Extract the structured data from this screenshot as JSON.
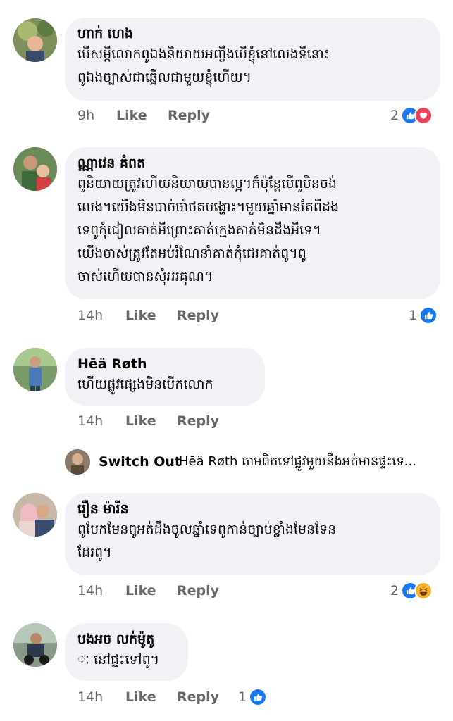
{
  "icons": {
    "like_color": "#1877f2",
    "love_color": "#f33e58",
    "haha_color": "#f7b125"
  },
  "comments": [
    {
      "author": "ហាក់ ហេង",
      "lines": [
        "បើសម្ដីលោកពូឯងនិយាយអញ្ចឹងបើខ្ញុំនៅលេងទីនោះ",
        "ពូឯងច្បាស់ជាឆ្អើលជាមួយខ្ញុំហើយ។"
      ],
      "time": "9h",
      "like": "Like",
      "reply": "Reply",
      "reaction_count": "2",
      "reactions": [
        "like-icon",
        "love-icon"
      ]
    },
    {
      "author": "ណ្ណាវេន គំពត",
      "lines": [
        "ពូនិយាយត្រូវហើយនិយាយបានល្អ។ក៏ប៉ុន្តែបើពូមិនចង់",
        "លេង។យើងមិនបាច់ចាំថតបង្ហោះ។មួយឆ្នាំមានតែពីដង",
        "ទេពូកុំជៀលគាត់អីព្រោះគាត់ក្មេងគាត់មិនដឹងអីទេ។",
        "យើងចាស់ត្រូវតែអប់រំណែនាំគាត់កុំជេរគាត់ពូ។ពូ",
        "ចាស់ហើយបានសុំអរគុណ។"
      ],
      "time": "14h",
      "like": "Like",
      "reply": "Reply",
      "reaction_count": "1",
      "reactions": [
        "like-icon"
      ]
    },
    {
      "author": "Hēä Røth",
      "lines": [
        "ហើយផ្លូវផ្សេងមិនបើកលោក"
      ],
      "time": "14h",
      "like": "Like",
      "reply": "Reply",
      "reaction_count": "",
      "reactions": []
    },
    {
      "author": "រឿន ម៉ារីន",
      "lines": [
        "ពូបែកមែនពូអត់ដឹងចូលឆ្នាំទេពូកាន់ច្បាប់ខ្លាំងមែនទែន",
        "ដែរពូ។"
      ],
      "time": "14h",
      "like": "Like",
      "reply": "Reply",
      "reaction_count": "2",
      "reactions": [
        "like-icon",
        "haha-icon"
      ]
    },
    {
      "author": "បងអច លក់ម៉ូតូ",
      "lines": [
        "ៈ នៅផ្ទះទៅពូ។"
      ],
      "time": "14h",
      "like": "Like",
      "reply": "Reply",
      "reaction_count": "1",
      "reactions": [
        "like-icon"
      ]
    }
  ],
  "reply_preview": {
    "author": "Switch Out",
    "text": "Hēä Røth តាមពិតទៅផ្លូវមួយនឹងអត់មានផ្ទះទេ..."
  }
}
